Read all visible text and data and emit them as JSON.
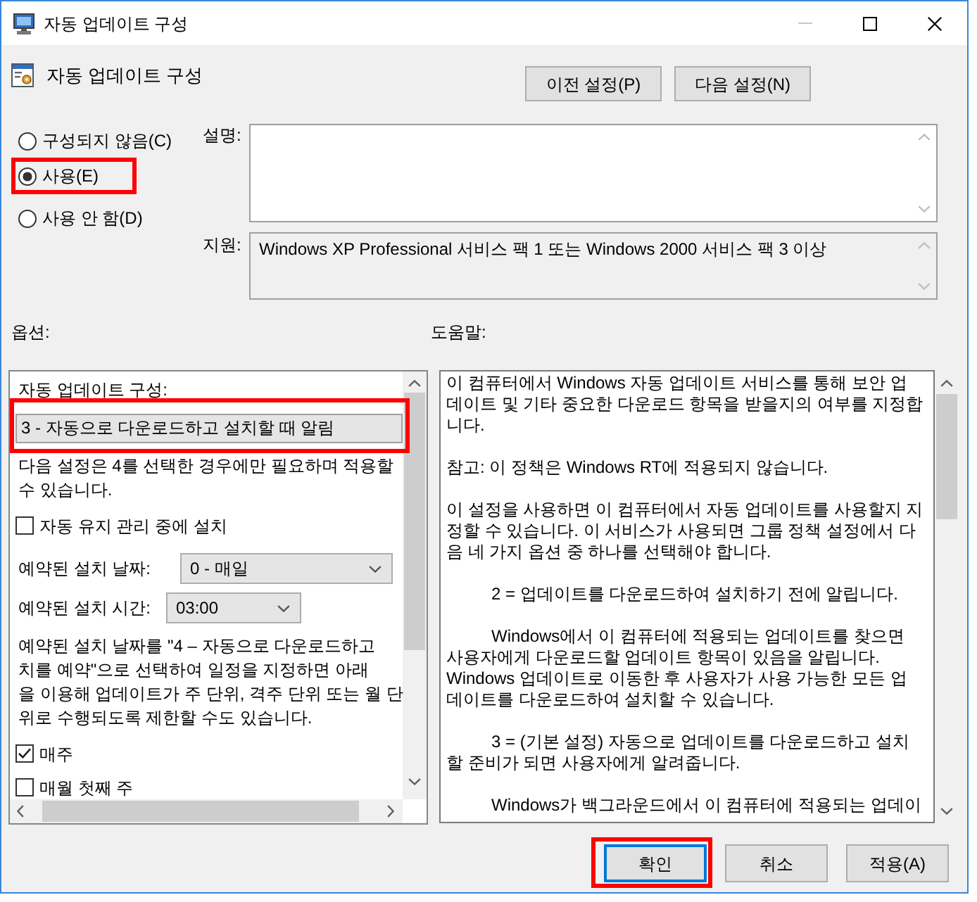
{
  "window": {
    "title": "자동 업데이트 구성",
    "minimize_disabled": true
  },
  "header": {
    "title": "자동 업데이트 구성"
  },
  "nav_buttons": [
    {
      "label": "이전 설정(P)"
    },
    {
      "label": "다음 설정(N)"
    }
  ],
  "state_options": [
    {
      "label": "구성되지 않음(C)",
      "selected": false,
      "highlighted": false
    },
    {
      "label": "사용(E)",
      "selected": true,
      "highlighted": true
    },
    {
      "label": "사용 안 함(D)",
      "selected": false,
      "highlighted": false
    }
  ],
  "description": {
    "label": "설명:"
  },
  "supported_on": {
    "label": "지원:",
    "value": "Windows XP Professional 서비스 팩 1 또는 Windows 2000 서비스 팩 3 이상"
  },
  "options": {
    "label": "옵션:",
    "items": [
      {
        "kind": "heading",
        "text": "자동 업데이트 구성:"
      },
      {
        "kind": "select",
        "value": "3 - 자동으로 다운로드하고 설치할 때 알림",
        "highlighted": true
      },
      {
        "kind": "note",
        "text": "다음 설정은 4를 선택한 경우에만 필요하며 적용할\n수 있습니다."
      },
      {
        "kind": "checkbox",
        "label": "자동 유지 관리 중에 설치",
        "checked": false
      },
      {
        "kind": "labeled_select",
        "label": "예약된 설치 날짜:",
        "value": "0 - 매일"
      },
      {
        "kind": "labeled_select",
        "label": "예약된 설치 시간:",
        "value": "03:00"
      },
      {
        "kind": "note",
        "text": "예약된 설치 날짜를 \"4 – 자동으로 다운로드하고\n치를 예약\"으로 선택하여 일정을 지정하면 아래\n을 이용해 업데이트가 주 단위, 격주 단위 또는 월 단\n위로 수행되도록 제한할 수도 있습니다."
      },
      {
        "kind": "checkbox",
        "label": "매주",
        "checked": true
      },
      {
        "kind": "checkbox",
        "label": "매월 첫째 주",
        "checked": false
      }
    ]
  },
  "help": {
    "label": "도움말:",
    "paragraphs": [
      {
        "text": "이 컴퓨터에서 Windows 자동 업데이트 서비스를 통해 보안 업\n데이트 및 기타 중요한 다운로드 항목을 받을지의 여부를 지정합\n니다.",
        "indented": false
      },
      {
        "text": "참고: 이 정책은 Windows RT에 적용되지 않습니다.",
        "indented": false
      },
      {
        "text": "이 설정을 사용하면 이 컴퓨터에서 자동 업데이트를 사용할지 지\n정할 수 있습니다. 이 서비스가 사용되면 그룹 정책 설정에서 다\n음 네 가지 옵션 중 하나를 선택해야 합니다.",
        "indented": false
      },
      {
        "text": "2 = 업데이트를 다운로드하여 설치하기 전에 알립니다.",
        "indented": true
      },
      {
        "text": "Windows에서 이 컴퓨터에 적용되는 업데이트를 찾으면\n사용자에게 다운로드할 업데이트 항목이 있음을 알립니다.\nWindows 업데이트로 이동한 후 사용자가 사용 가능한 모든 업\n데이트를 다운로드하여 설치할 수 있습니다.",
        "indented": true
      },
      {
        "text": "3 = (기본 설정) 자동으로 업데이트를 다운로드하고 설치\n할 준비가 되면 사용자에게 알려줍니다.",
        "indented": true
      },
      {
        "text": "Windows가 백그라운드에서 이 컴퓨터에 적용되는 업데이",
        "indented": true
      }
    ]
  },
  "buttons": [
    {
      "label": "확인",
      "focused": true,
      "highlighted": true
    },
    {
      "label": "취소",
      "focused": false,
      "highlighted": false
    },
    {
      "label": "적용(A)",
      "focused": false,
      "highlighted": false
    }
  ]
}
